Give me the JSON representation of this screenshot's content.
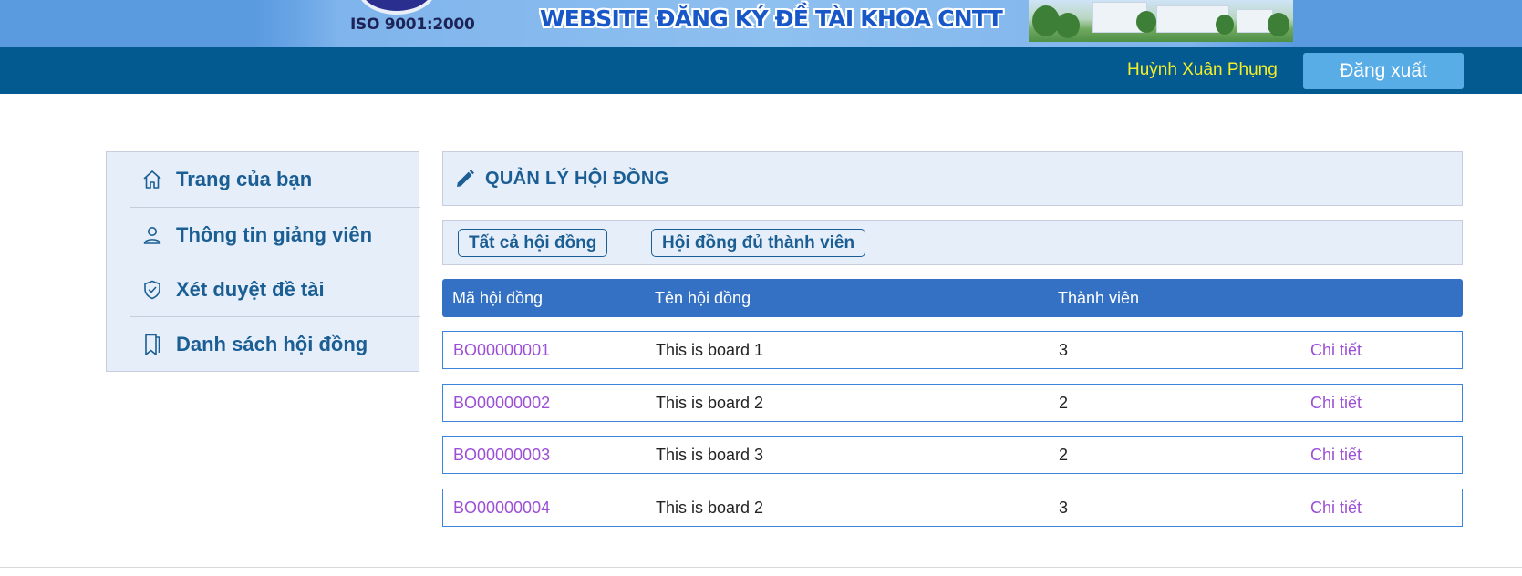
{
  "banner": {
    "iso": "ISO 9001:2000",
    "title": "WEBSITE ĐĂNG KÝ ĐỀ TÀI KHOA CNTT"
  },
  "navbar": {
    "user_name": "Huỳnh Xuân Phụng",
    "logout_label": "Đăng xuất"
  },
  "sidebar": {
    "items": [
      {
        "label": "Trang của bạn",
        "icon": "home-icon"
      },
      {
        "label": "Thông tin giảng viên",
        "icon": "user-icon"
      },
      {
        "label": "Xét duyệt đề tài",
        "icon": "shield-check-icon"
      },
      {
        "label": "Danh sách hội đồng",
        "icon": "bookmark-icon"
      }
    ]
  },
  "main": {
    "title": "QUẢN LÝ HỘI ĐỒNG",
    "filters": [
      "Tất cả hội đồng",
      "Hội đồng đủ thành viên"
    ],
    "table": {
      "headers": [
        "Mã hội đồng",
        "Tên hội đồng",
        "Thành viên"
      ],
      "rows": [
        {
          "code": "BO00000001",
          "name": "This is board 1",
          "members": "3",
          "action": "Chi tiết"
        },
        {
          "code": "BO00000002",
          "name": "This is board 2",
          "members": "2",
          "action": "Chi tiết"
        },
        {
          "code": "BO00000003",
          "name": "This is board 3",
          "members": "2",
          "action": "Chi tiết"
        },
        {
          "code": "BO00000004",
          "name": "This is board 2",
          "members": "3",
          "action": "Chi tiết"
        }
      ]
    }
  },
  "colors": {
    "navbar": "#035a91",
    "accent": "#1a5e93",
    "table_header": "#3470c3",
    "link": "#9b4fd6",
    "user_name": "#f4ee2a"
  }
}
